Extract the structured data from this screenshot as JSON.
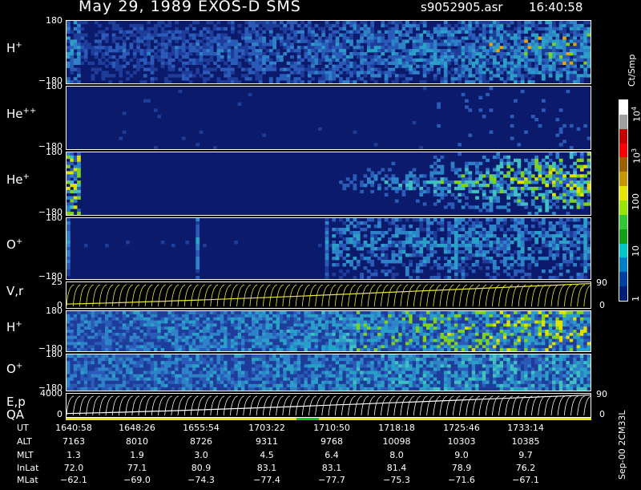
{
  "header": {
    "title": "May 29, 1989   EXOS-D SMS",
    "file": "s9052905.asr",
    "time": "16:40:58"
  },
  "panels": [
    {
      "id": "hplus1",
      "label": "H",
      "sup": "+",
      "ymax": "180",
      "ymin": "−180"
    },
    {
      "id": "hepp",
      "label": "He",
      "sup": "++",
      "ymax": "180",
      "ymin": "−180"
    },
    {
      "id": "hep",
      "label": "He",
      "sup": "+",
      "ymax": "180",
      "ymin": "−180"
    },
    {
      "id": "oplus1",
      "label": "O",
      "sup": "+",
      "ymax": "180",
      "ymin": "−180"
    },
    {
      "id": "vr",
      "label": "V,r",
      "ymax": "25",
      "ymin": "0",
      "right_top": "90",
      "right_bot": "0"
    },
    {
      "id": "hplus2",
      "label": "H",
      "sup": "+",
      "ymax": "180",
      "ymin": "−180"
    },
    {
      "id": "oplus2",
      "label": "O",
      "sup": "+",
      "ymax": "180",
      "ymin": "−180"
    },
    {
      "id": "ep",
      "label": "E,p",
      "label2": "QA",
      "ymax": "4000",
      "ymin": "0",
      "right_top": "90",
      "right_bot": "0"
    }
  ],
  "colorbar": {
    "unit": "Ct/Smp",
    "labels": [
      "10",
      "10",
      "100",
      "10",
      "1"
    ],
    "exp": [
      "4",
      "3",
      "",
      "",
      ""
    ],
    "colors": [
      "#ffffff",
      "#a0a0a0",
      "#c80000",
      "#ff0000",
      "#a06000",
      "#c89600",
      "#e6e600",
      "#96e600",
      "#32c832",
      "#14a014",
      "#00c8c8",
      "#0080c8",
      "#0040a0",
      "#001e78"
    ]
  },
  "side_note": "Sep-00  2CM33L",
  "table": {
    "rows": [
      {
        "name": "UT",
        "values": [
          "1640:58",
          "1648:26",
          "1655:54",
          "1703:22",
          "1710:50",
          "1718:18",
          "1725:46",
          "1733:14"
        ]
      },
      {
        "name": "ALT",
        "values": [
          "7163",
          "8010",
          "8726",
          "9311",
          "9768",
          "10098",
          "10303",
          "10385"
        ]
      },
      {
        "name": "MLT",
        "values": [
          "1.3",
          "1.9",
          "3.0",
          "4.5",
          "6.4",
          "8.0",
          "9.0",
          "9.7"
        ]
      },
      {
        "name": "InLat",
        "values": [
          "72.0",
          "77.1",
          "80.9",
          "83.1",
          "83.1",
          "81.4",
          "78.9",
          "76.2"
        ]
      },
      {
        "name": "MLat",
        "values": [
          "−62.1",
          "−69.0",
          "−74.3",
          "−77.4",
          "−77.7",
          "−75.3",
          "−71.6",
          "−67.1"
        ]
      }
    ]
  },
  "chart_data": {
    "type": "heatmap",
    "title": "May 29, 1989   EXOS-D SMS",
    "x_ticks": [
      "1640:58",
      "1648:26",
      "1655:54",
      "1703:22",
      "1710:50",
      "1718:18",
      "1725:46",
      "1733:14"
    ],
    "panels": [
      "H+",
      "He++",
      "He+",
      "O+",
      "V,r",
      "H+",
      "O+",
      "E,p QA"
    ],
    "colorbar_range": [
      1,
      10000
    ],
    "colorbar_unit": "Ct/Smp",
    "colorbar_scale": "log"
  }
}
